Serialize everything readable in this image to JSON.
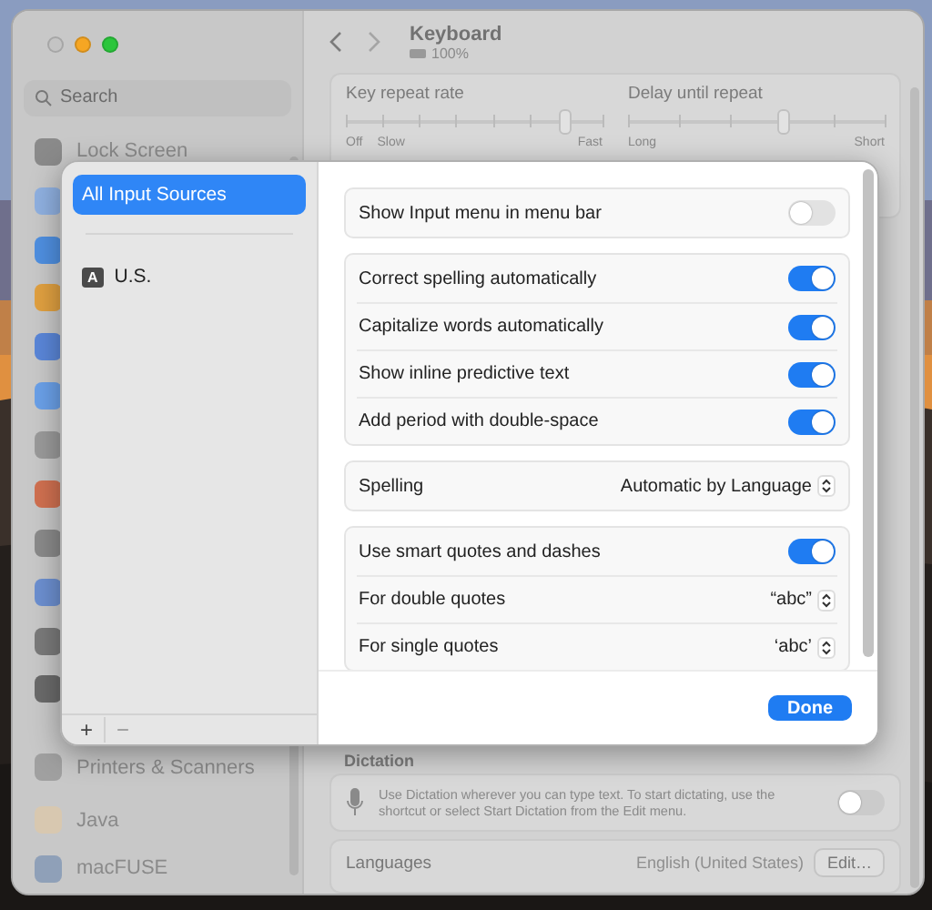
{
  "window": {
    "title": "Keyboard",
    "subtitle": "100%"
  },
  "search": {
    "placeholder": "Search"
  },
  "sidebar": {
    "top_items": [
      {
        "label": "Lock Screen"
      }
    ],
    "bottom_items": [
      {
        "label": "Printers & Scanners"
      }
    ],
    "apps": [
      {
        "label": "Java"
      },
      {
        "label": "macFUSE"
      }
    ]
  },
  "sliders": [
    {
      "label": "Key repeat rate",
      "level": 0.85,
      "labels": [
        "Off",
        "Slow",
        "Fast"
      ]
    },
    {
      "label": "Delay until repeat",
      "level": 0.6,
      "labels": [
        "Long",
        "Short"
      ]
    }
  ],
  "dictation": {
    "heading": "Dictation",
    "text": "Use Dictation wherever you can type text. To start dictating, use the shortcut or select Start Dictation from the Edit menu.",
    "on": false
  },
  "languages": {
    "label": "Languages",
    "value": "English (United States)",
    "button": "Edit…"
  },
  "sheet": {
    "sources": [
      {
        "label": "All Input Sources",
        "selected": true
      },
      {
        "label": "U.S.",
        "badge": "A",
        "selected": false
      }
    ],
    "add": "+",
    "remove": "−",
    "groups": [
      {
        "rows": [
          {
            "kind": "toggle",
            "label": "Show Input menu in menu bar",
            "on": false
          }
        ]
      },
      {
        "rows": [
          {
            "kind": "toggle",
            "label": "Correct spelling automatically",
            "on": true
          },
          {
            "kind": "toggle",
            "label": "Capitalize words automatically",
            "on": true
          },
          {
            "kind": "toggle",
            "label": "Show inline predictive text",
            "on": true
          },
          {
            "kind": "toggle",
            "label": "Add period with double-space",
            "on": true
          }
        ]
      },
      {
        "rows": [
          {
            "kind": "popup",
            "label": "Spelling",
            "value": "Automatic by Language"
          }
        ]
      },
      {
        "rows": [
          {
            "kind": "toggle",
            "label": "Use smart quotes and dashes",
            "on": true
          },
          {
            "kind": "popup",
            "label": "For double quotes",
            "value": "“abc”"
          },
          {
            "kind": "popup",
            "label": "For single quotes",
            "value": "‘abc’"
          }
        ]
      }
    ],
    "done": "Done"
  }
}
